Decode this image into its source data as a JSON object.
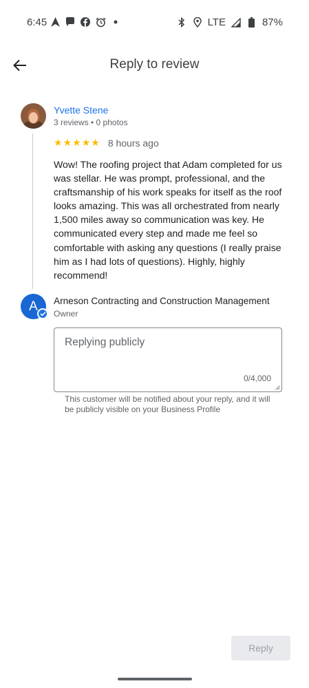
{
  "status_bar": {
    "time": "6:45",
    "left_icons": [
      "navigation-icon",
      "chat-bubble-icon",
      "facebook-icon",
      "alarm-icon",
      "dot-icon"
    ],
    "right_icons": [
      "bluetooth-icon",
      "location-icon",
      "signal-icon",
      "battery-icon"
    ],
    "network": "LTE",
    "battery": "87%"
  },
  "app_bar": {
    "title": "Reply to review",
    "back_icon": "arrow-back-icon"
  },
  "review": {
    "reviewer_name": "Yvette Stene",
    "reviewer_meta": "3 reviews • 0 photos",
    "rating": 5,
    "time": "8 hours ago",
    "text": "Wow! The roofing project that Adam completed for us was stellar. He was prompt, professional, and the craftsmanship of his work speaks for itself as the roof looks amazing. This was all orchestrated from nearly 1,500 miles away so communication was key. He communicated every step and made me feel so comfortable with asking any questions (I really praise him as I had lots of questions). Highly, highly recommend!"
  },
  "owner": {
    "avatar_letter": "A",
    "name": "Arneson Contracting and Construction Management",
    "role": "Owner"
  },
  "reply": {
    "placeholder": "Replying publicly",
    "value": "",
    "counter": "0/4,000",
    "helper": "This customer will be notified about your reply, and it will be publicly visible on your Business Profile",
    "button_label": "Reply"
  },
  "colors": {
    "link_blue": "#1a73e8",
    "star_yellow": "#fbbc04",
    "owner_avatar": "#1967d2"
  }
}
